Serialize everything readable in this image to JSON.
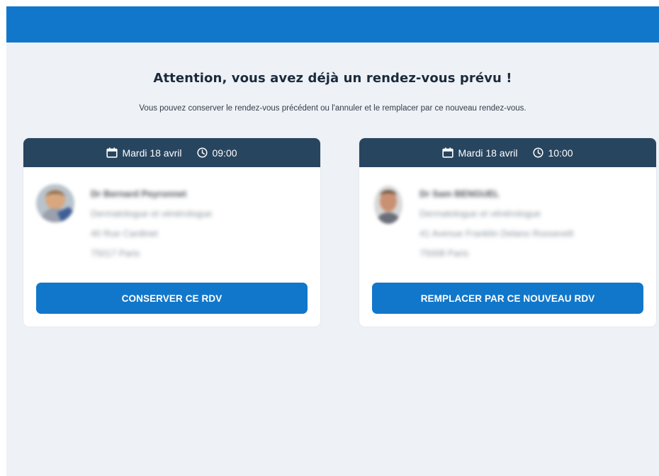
{
  "page": {
    "title": "Attention, vous avez déjà un rendez-vous prévu !",
    "subtitle": "Vous pouvez conserver le rendez-vous précédent ou l'annuler et le remplacer par ce nouveau rendez-vous."
  },
  "colors": {
    "header_bar": "#1177cb",
    "background": "#eef1f6",
    "card_header": "#284560",
    "button": "#1177cb"
  },
  "appointments": [
    {
      "date": "Mardi 18 avril",
      "time": "09:00",
      "calendar_icon": "calendar-icon",
      "clock_icon": "clock-icon",
      "doctor_name": "Dr Bernard Peyronnet",
      "specialty": "Dermatologue et vénérologue",
      "address": "40 Rue Cardinet",
      "city": "75017 Paris",
      "button_label": "CONSERVER CE RDV"
    },
    {
      "date": "Mardi 18 avril",
      "time": "10:00",
      "calendar_icon": "calendar-icon",
      "clock_icon": "clock-icon",
      "doctor_name": "Dr Sam BENGUEL",
      "specialty": "Dermatologue et vénérologue",
      "address": "41 Avenue Franklin Delano Roosevelt",
      "city": "75008 Paris",
      "button_label": "REMPLACER PAR CE NOUVEAU RDV"
    }
  ]
}
